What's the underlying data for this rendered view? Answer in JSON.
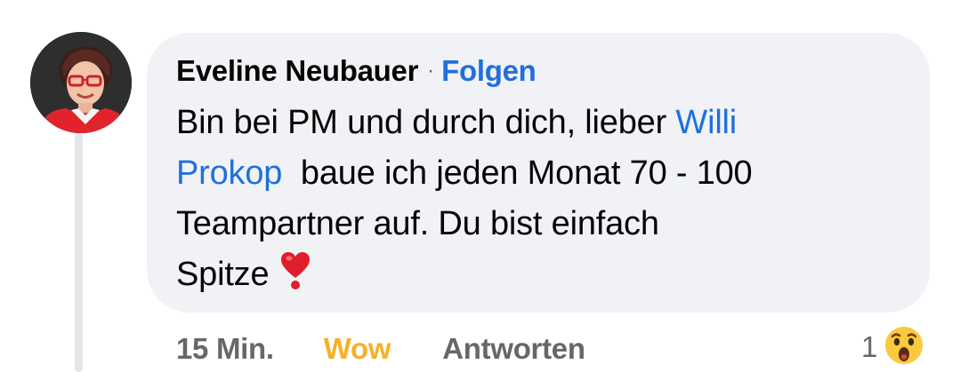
{
  "comment": {
    "author": "Eveline Neubauer",
    "separator": "·",
    "follow_label": "Folgen",
    "text": {
      "line1_before": "Bin bei PM und durch dich, lieber ",
      "mention_first": "Willi",
      "mention_last": "Prokop",
      "line2_after": "  baue ich jeden Monat 70 - 100",
      "line3": "Teampartner auf. Du bist einfach",
      "line4": "Spitze"
    },
    "emoji_icon": "red-heart-exclamation-icon"
  },
  "actions": {
    "timestamp": "15 Min.",
    "reaction_label": "Wow",
    "reply_label": "Antworten"
  },
  "reaction_summary": {
    "count": "1",
    "icon": "wow-reaction-icon"
  },
  "colors": {
    "bubble_background": "#f0f2f5",
    "link_blue": "#216fdb",
    "wow_yellow": "#f7b125",
    "secondary_gray": "#65676b",
    "text_primary": "#050505"
  }
}
